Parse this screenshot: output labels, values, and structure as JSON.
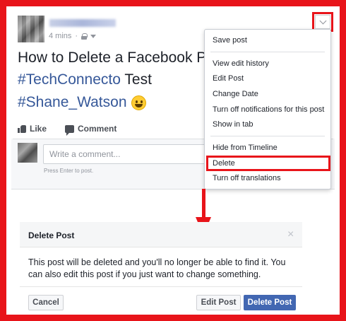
{
  "post": {
    "time": "4 mins",
    "title": "How to Delete a Facebook P",
    "hashtag1": "#TechConnecto",
    "text_after_hashtag1": " Test",
    "hashtag2": "#Shane_Watson",
    "emoji": "grinning-face-emoji"
  },
  "actions": {
    "like_label": "Like",
    "comment_label": "Comment"
  },
  "comment_box": {
    "placeholder": "Write a comment...",
    "hint": "Press Enter to post."
  },
  "menu": {
    "items": [
      "Save post",
      "View edit history",
      "Edit Post",
      "Change Date",
      "Turn off notifications for this post",
      "Show in tab",
      "Hide from Timeline",
      "Delete",
      "Turn off translations"
    ]
  },
  "dialog": {
    "title": "Delete Post",
    "close": "×",
    "body": "This post will be deleted and you'll no longer be able to find it. You can also edit this post if you just want to change something.",
    "cancel_label": "Cancel",
    "edit_label": "Edit Post",
    "delete_label": "Delete Post"
  },
  "colors": {
    "annotation_red": "#e8141a",
    "hashtag_blue": "#365899",
    "primary_button": "#4267b2"
  }
}
